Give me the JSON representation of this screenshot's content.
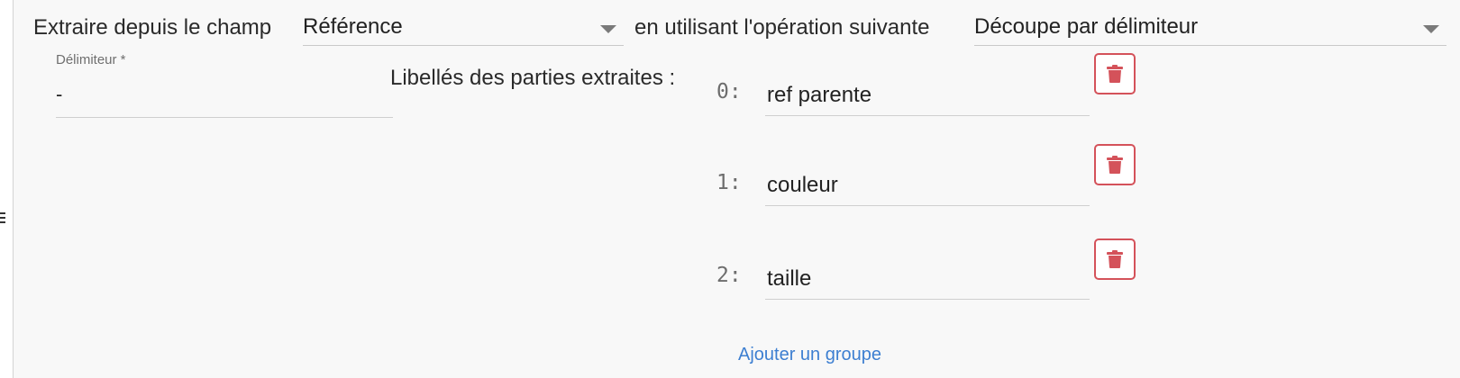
{
  "source": {
    "prefix_label": "Extraire depuis le champ",
    "field_value": "Référence"
  },
  "operation": {
    "prefix_label": "en utilisant l'opération suivante",
    "value": "Découpe par délimiteur"
  },
  "delimiter": {
    "label": "Délimiteur *",
    "value": "-"
  },
  "parts": {
    "heading": "Libellés des parties extraites :",
    "items": [
      {
        "index": "0:",
        "value": "ref parente"
      },
      {
        "index": "1:",
        "value": "couleur"
      },
      {
        "index": "2:",
        "value": "taille"
      }
    ],
    "add_label": "Ajouter un groupe"
  },
  "icons": {
    "delete": "trash-icon",
    "dropdown": "caret-down-icon",
    "drag": "drag-handle-icon"
  },
  "colors": {
    "danger": "#d4525a",
    "link": "#3d7fd1"
  }
}
